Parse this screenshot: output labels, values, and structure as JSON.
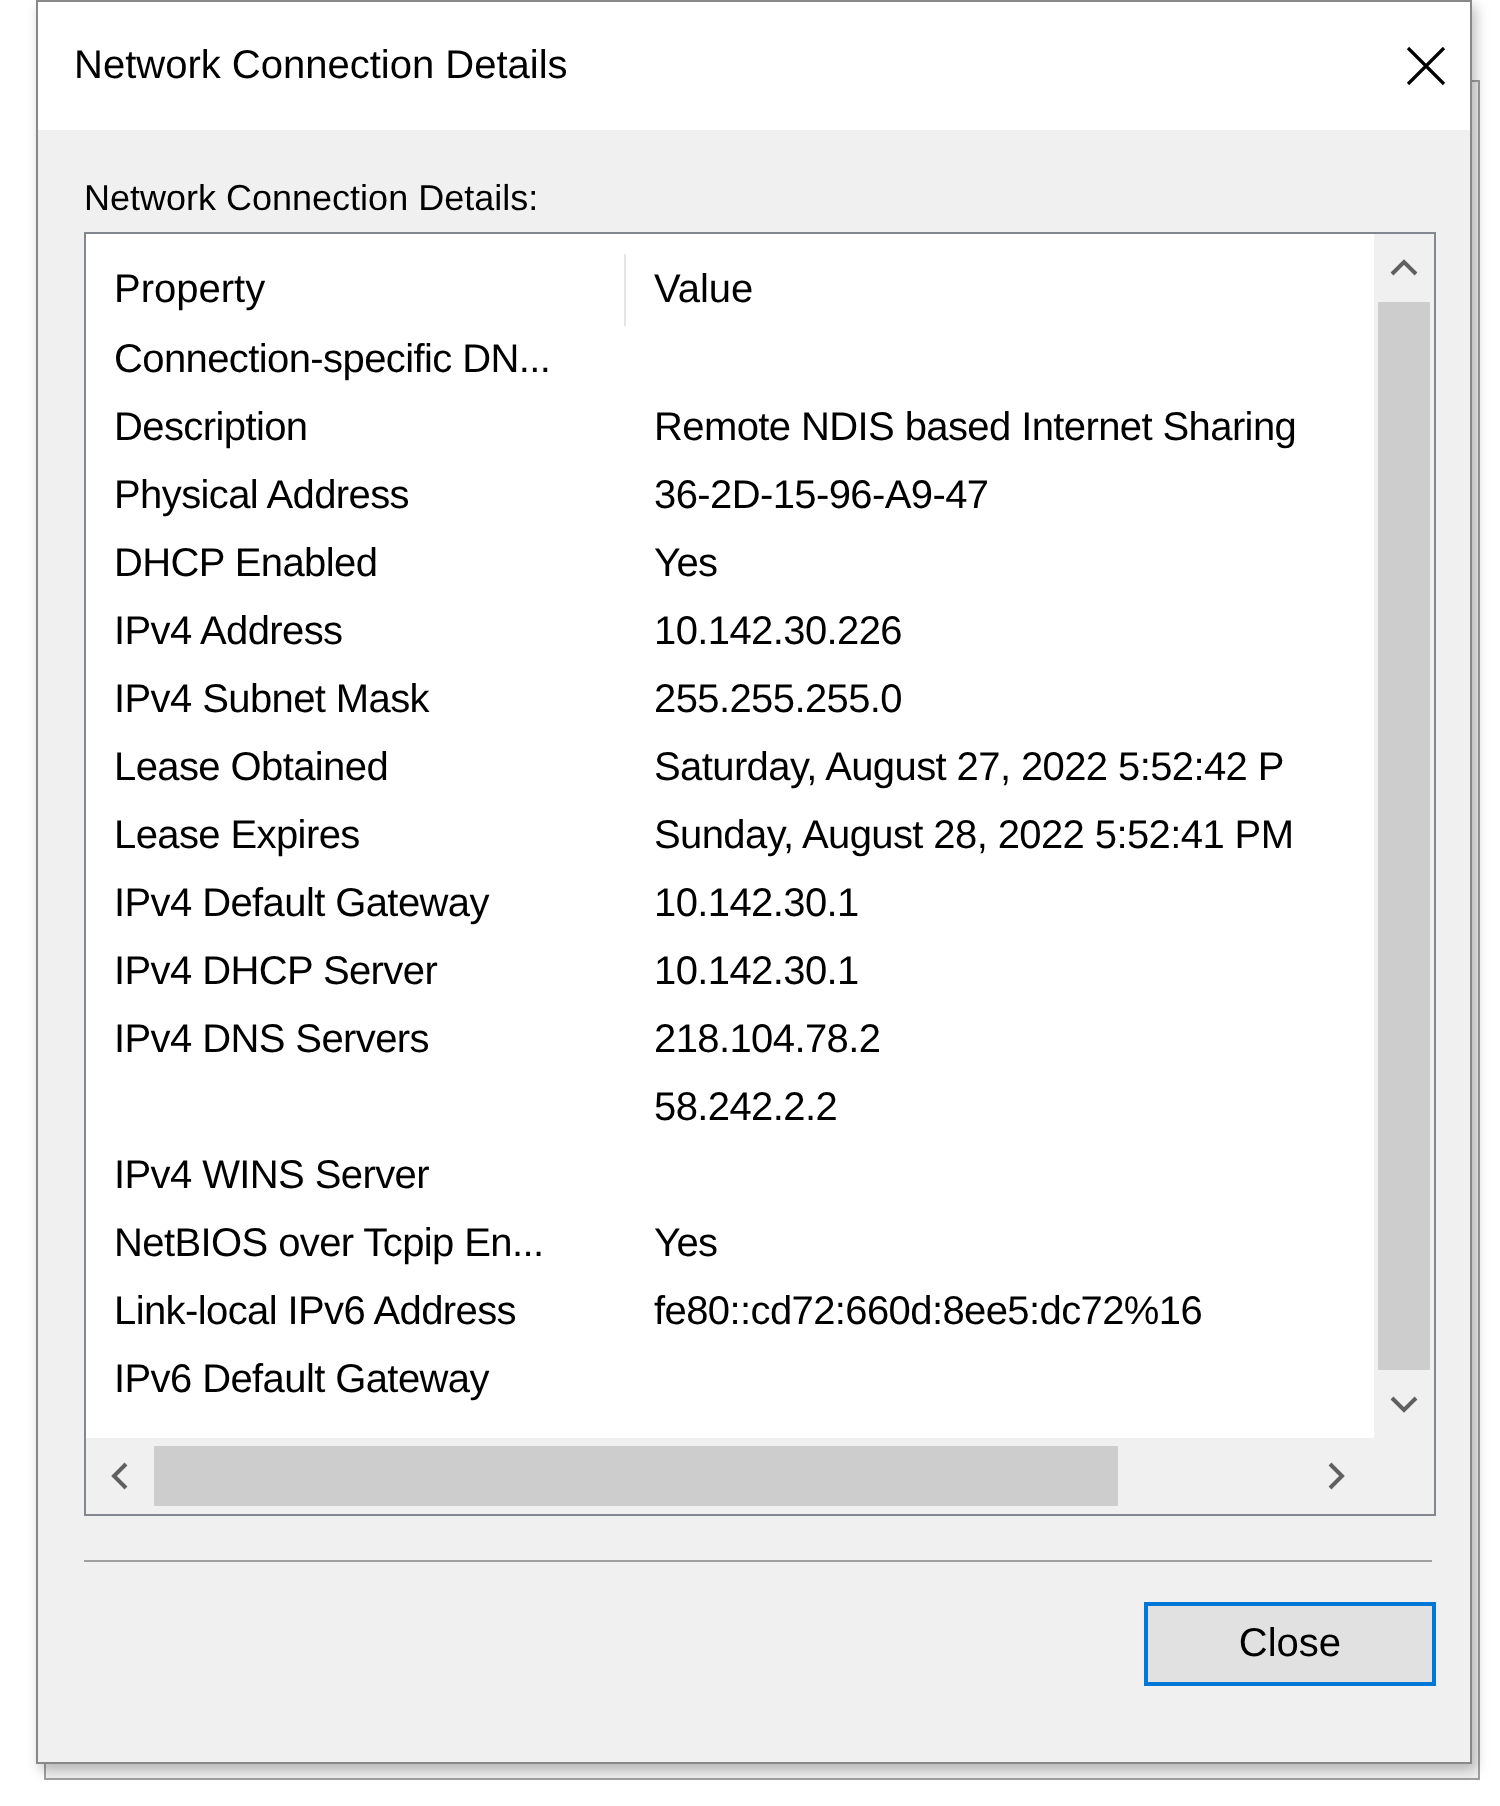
{
  "window": {
    "title": "Network Connection Details"
  },
  "group_label": "Network Connection Details:",
  "table": {
    "columns": [
      "Property",
      "Value"
    ],
    "rows": [
      {
        "property": "Connection-specific DN..."
      },
      {
        "property": "Description",
        "value": "Remote NDIS based Internet Sharing"
      },
      {
        "property": "Physical Address",
        "value": "36-2D-15-96-A9-47"
      },
      {
        "property": "DHCP Enabled",
        "value": "Yes"
      },
      {
        "property": "IPv4 Address",
        "value": "10.142.30.226"
      },
      {
        "property": "IPv4 Subnet Mask",
        "value": "255.255.255.0"
      },
      {
        "property": "Lease Obtained",
        "value": "Saturday, August 27, 2022 5:52:42 P"
      },
      {
        "property": "Lease Expires",
        "value": "Sunday, August 28, 2022 5:52:41 PM"
      },
      {
        "property": "IPv4 Default Gateway",
        "value": "10.142.30.1"
      },
      {
        "property": "IPv4 DHCP Server",
        "value": "10.142.30.1"
      },
      {
        "property": "IPv4 DNS Servers",
        "value": "218.104.78.2"
      },
      {
        "value": "58.242.2.2"
      },
      {
        "property": "IPv4 WINS Server"
      },
      {
        "property": "NetBIOS over Tcpip En...",
        "value": "Yes"
      },
      {
        "property": "Link-local IPv6 Address",
        "value": "fe80::cd72:660d:8ee5:dc72%16"
      },
      {
        "property": "IPv6 Default Gateway"
      }
    ]
  },
  "buttons": [
    {
      "label": "Close"
    }
  ]
}
